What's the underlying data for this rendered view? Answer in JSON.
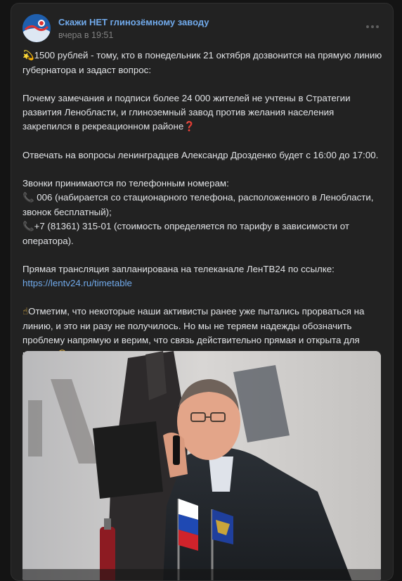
{
  "post": {
    "group_name": "Скажи НЕТ глинозёмному заводу",
    "time": "вчера в 19:51",
    "paragraphs": {
      "p1_emoji": "💫",
      "p1_text": "1500 рублей - тому, кто в понедельник 21 октября дозвонится на прямую линию губернатора и задаст вопрос:",
      "p2_text": "Почему замечания и подписи более 24 000 жителей не учтены в Стратегии развития Ленобласти, и глиноземный завод против желания населения закрепился в рекреационном районе",
      "p2_emoji": "❓",
      "p3_text": "Отвечать на вопросы ленинградцев Александр Дрозденко будет с 16:00 до 17:00.",
      "p4_intro": "Звонки принимаются по телефонным номерам:",
      "phone_emoji": "📞",
      "p4_line1": " 006 (набирается со стационарного телефона, расположенного в Ленобласти, звонок бесплатный);",
      "p4_line2": "+7 (81361) 315-01 (стоимость определяется по тарифу в зависимости от оператора).",
      "p5_text": "Прямая трансляция запланирована на телеканале ЛенТВ24 по ссылке:",
      "p5_link": "https://lentv24.ru/timetable",
      "p6_emoji": "☝",
      "p6_text": "Отметим, что некоторые наши активисты ранее уже пытались прорваться на линию, и это ни разу не получилось. Но мы не теряем надежды обозначить проблему напрямую и верим, что связь действительно прямая и открыта для каждого",
      "p6_end_emoji": "😉"
    },
    "icons": {
      "more": "more-horizontal-icon",
      "avatar": "group-avatar"
    },
    "colors": {
      "background": "#141414",
      "card": "#222222",
      "link": "#71aaeb",
      "text": "#e1e3e6",
      "muted": "#828282"
    }
  }
}
